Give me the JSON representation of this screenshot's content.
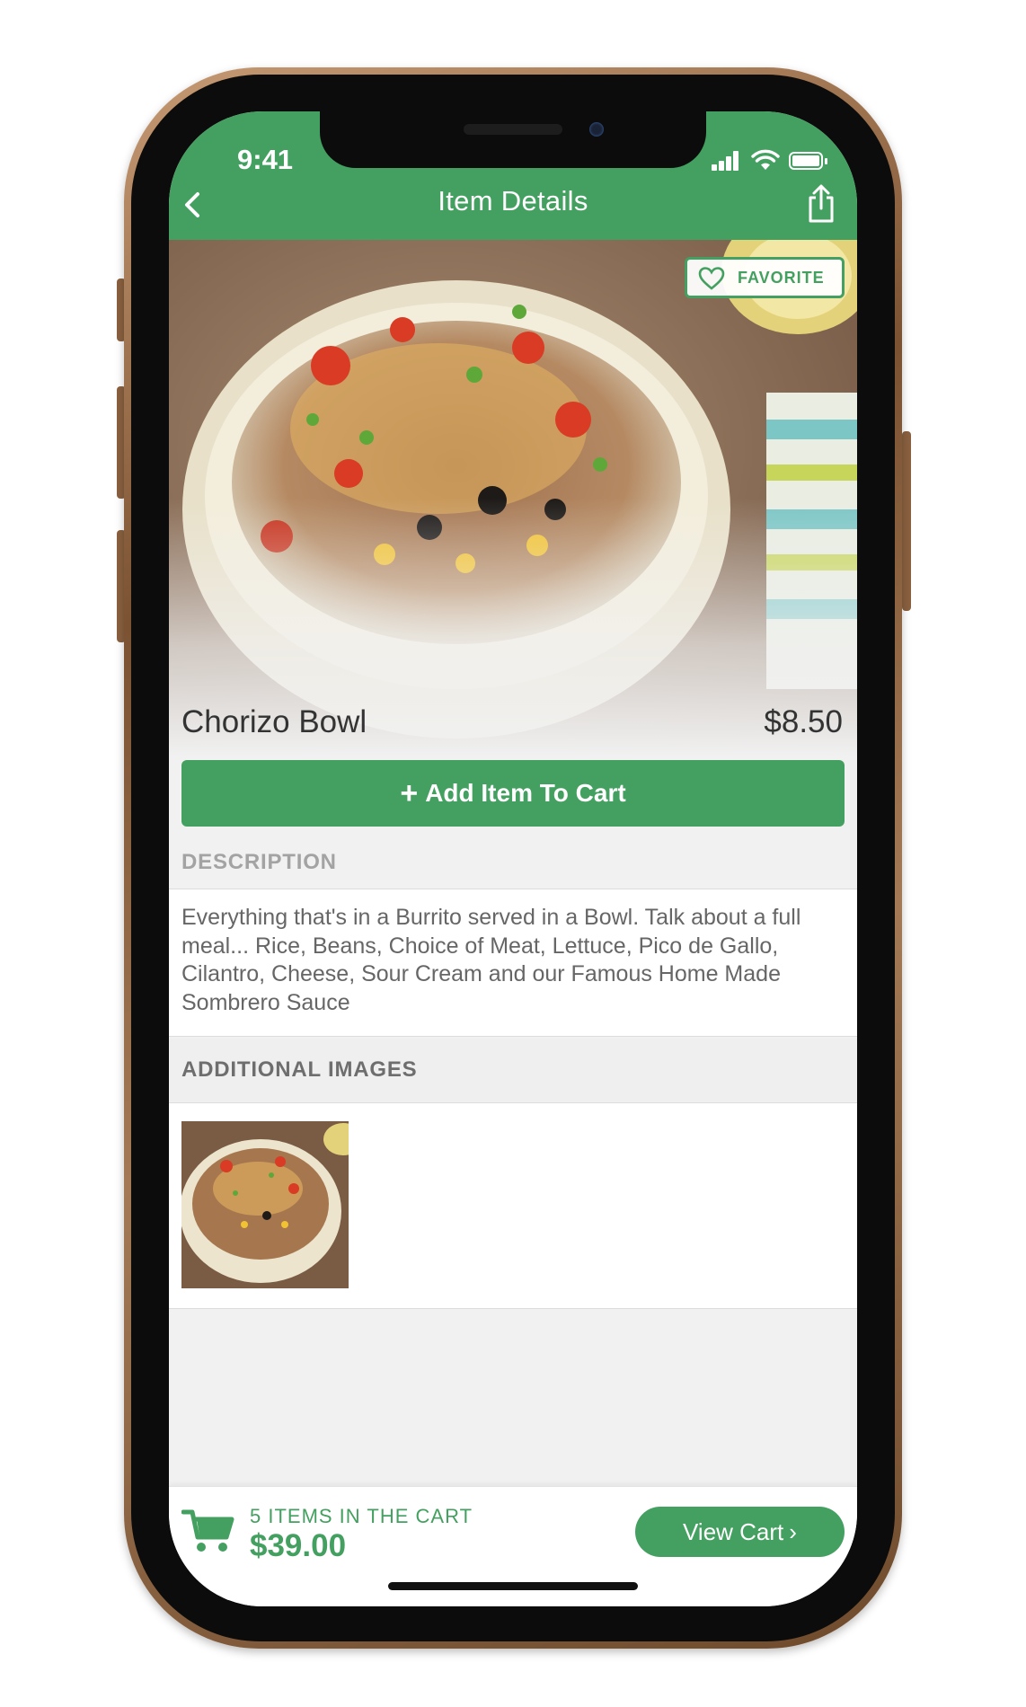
{
  "status_bar": {
    "time": "9:41"
  },
  "nav": {
    "title": "Item Details"
  },
  "hero": {
    "favorite_label": "FAVORITE"
  },
  "item": {
    "name": "Chorizo Bowl",
    "price": "$8.50"
  },
  "add_to_cart": {
    "plus": "+",
    "label": "Add Item To Cart"
  },
  "description": {
    "header": "DESCRIPTION",
    "text": "Everything that's in a Burrito served in a Bowl. Talk about a full meal... Rice, Beans, Choice of Meat, Lettuce, Pico de Gallo, Cilantro, Cheese, Sour Cream and our Famous Home Made Sombrero Sauce"
  },
  "additional_images": {
    "header": "ADDITIONAL IMAGES"
  },
  "cart": {
    "count_label": "5 ITEMS IN THE CART",
    "total": "$39.00",
    "view_cart_label": "View Cart",
    "chevron": "›"
  },
  "colors": {
    "brand_green": "#44a060",
    "background": "#f1f1f1"
  },
  "icons": [
    "back-chevron-icon",
    "share-icon",
    "heart-icon",
    "cart-icon",
    "signal-icon",
    "wifi-icon",
    "battery-icon"
  ]
}
